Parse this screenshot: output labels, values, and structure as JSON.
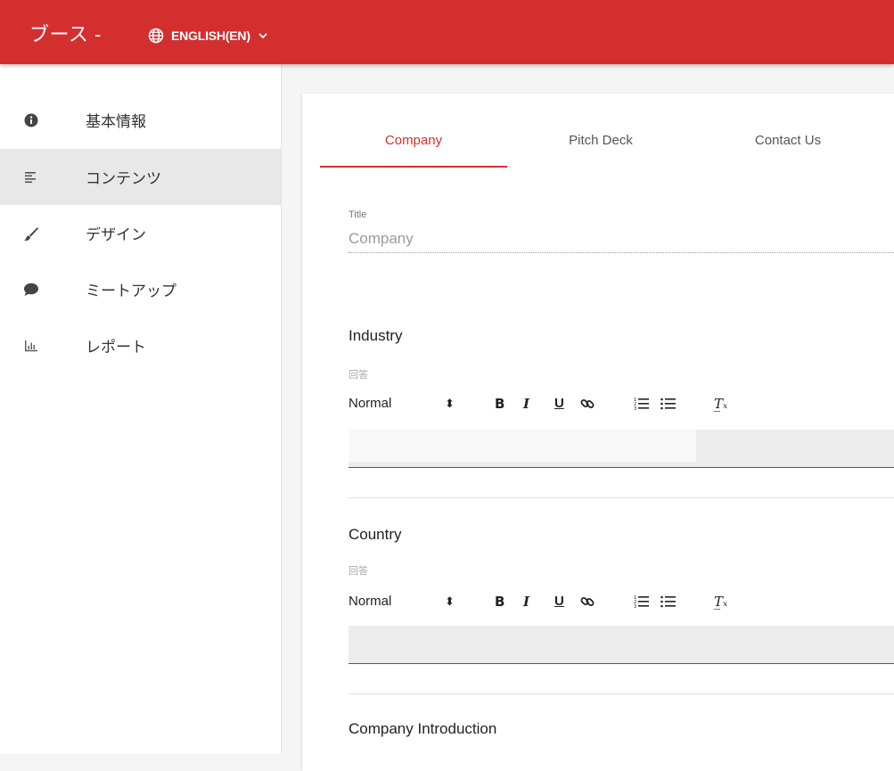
{
  "header": {
    "title": "ブース -",
    "language": "ENGLISH(EN)",
    "globe_icon": "globe-icon",
    "chevron_icon": "chevron-down-icon"
  },
  "colors": {
    "brand": "#d32f2f",
    "active_nav_bg": "#e8e8e8"
  },
  "sidebar": {
    "items": [
      {
        "label": "基本情報",
        "icon": "info-icon",
        "active": false
      },
      {
        "label": "コンテンツ",
        "icon": "text-lines-icon",
        "active": true
      },
      {
        "label": "デザイン",
        "icon": "brush-icon",
        "active": false
      },
      {
        "label": "ミートアップ",
        "icon": "chat-bubble-icon",
        "active": false
      },
      {
        "label": "レポート",
        "icon": "bar-chart-icon",
        "active": false
      }
    ]
  },
  "tabs": [
    {
      "label": "Company",
      "active": true
    },
    {
      "label": "Pitch Deck",
      "active": false
    },
    {
      "label": "Contact Us",
      "active": false
    }
  ],
  "form": {
    "title_field": {
      "label": "Title",
      "value": "Company"
    },
    "sections": [
      {
        "title": "Industry",
        "hint": "回答"
      },
      {
        "title": "Country",
        "hint": "回答"
      },
      {
        "title": "Company Introduction"
      }
    ]
  },
  "editor_toolbar": {
    "format": "Normal",
    "arrows": "⬍",
    "bold": "B",
    "italic": "I",
    "underline": "U",
    "clear": "T̲ₓ"
  }
}
